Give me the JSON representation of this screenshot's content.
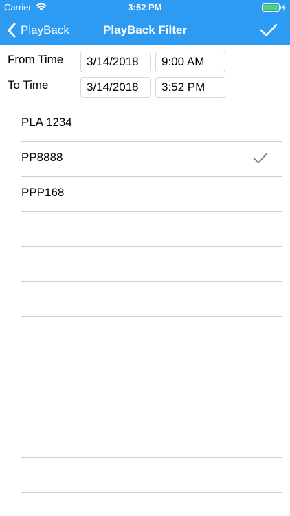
{
  "status_bar": {
    "carrier": "Carrier",
    "time": "3:52 PM"
  },
  "nav": {
    "back_label": "PlayBack",
    "title": "PlayBack Filter"
  },
  "filter": {
    "from_label": "From Time",
    "from_date": "3/14/2018",
    "from_time": "9:00 AM",
    "to_label": "To Time",
    "to_date": "3/14/2018",
    "to_time": "3:52 PM"
  },
  "vehicles": [
    {
      "label": "PLA 1234",
      "selected": false
    },
    {
      "label": "PP8888",
      "selected": true
    },
    {
      "label": "PPP168",
      "selected": false
    },
    {
      "label": "",
      "selected": false
    },
    {
      "label": "",
      "selected": false
    },
    {
      "label": "",
      "selected": false
    },
    {
      "label": "",
      "selected": false
    },
    {
      "label": "",
      "selected": false
    },
    {
      "label": "",
      "selected": false
    },
    {
      "label": "",
      "selected": false
    },
    {
      "label": "",
      "selected": false
    }
  ],
  "colors": {
    "nav_background": "#2e9bf2",
    "check_mark": "#6e7f80",
    "separator": "#cfcfcf"
  }
}
